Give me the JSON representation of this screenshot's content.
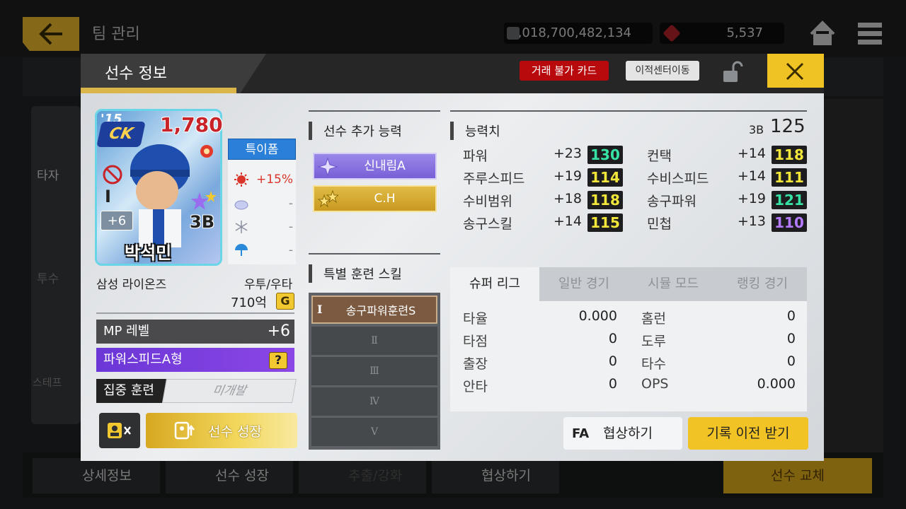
{
  "background": {
    "title": "팀 관리",
    "gold": "1,018,700,482,134",
    "gems": "5,537",
    "bottom_buttons": [
      "상세정보",
      "선수 성장",
      "추출/강화",
      "협상하기",
      "선수 교체"
    ],
    "side_labels": [
      "타자",
      "투수",
      "스테프"
    ]
  },
  "modal": {
    "title": "선수 정보",
    "trade_badge": "거래 불가 카드",
    "transfer_button": "이적센터이동",
    "close_icon": "close-icon",
    "accent_color": "#f0c324"
  },
  "card": {
    "year": "'15",
    "logo": "CK",
    "rating": "1,780",
    "plus": "+6",
    "position": "3B",
    "name": "박석민",
    "roman": "I",
    "special": "특이폼",
    "conditions": [
      {
        "icon": "sun-icon",
        "value": "+15%"
      },
      {
        "icon": "cloud-icon",
        "value": "-"
      },
      {
        "icon": "snow-icon",
        "value": "-"
      },
      {
        "icon": "umbrella-icon",
        "value": "-"
      }
    ]
  },
  "info": {
    "team": "삼성 라이온즈",
    "bats": "우투/우타",
    "salary": "710억",
    "salary_icon": "G",
    "mp_label": "MP 레벨",
    "mp_value": "+6",
    "type_label": "파워스피드A형",
    "type_help": "?",
    "focus_label": "집중 훈련",
    "focus_value": "미개발",
    "grow_button": "선수 성장"
  },
  "abilities": {
    "title": "선수 추가 능력",
    "items": [
      "신내림A",
      "C.H"
    ]
  },
  "training": {
    "title": "특별 훈련 스킬",
    "slots": [
      "송구파워훈련S",
      "Ⅱ",
      "Ⅲ",
      "Ⅳ",
      "Ⅴ"
    ],
    "slot1_icon": "I"
  },
  "stats": {
    "title": "능력치",
    "pos_small": "3B",
    "total": "125",
    "left": [
      {
        "name": "파워",
        "plus": "+23",
        "value": "130",
        "color": "green"
      },
      {
        "name": "주루스피드",
        "plus": "+19",
        "value": "114",
        "color": "yellow"
      },
      {
        "name": "수비범위",
        "plus": "+18",
        "value": "118",
        "color": "yellow"
      },
      {
        "name": "송구스킬",
        "plus": "+14",
        "value": "115",
        "color": "yellow"
      }
    ],
    "right": [
      {
        "name": "컨택",
        "plus": "+14",
        "value": "118",
        "color": "yellow"
      },
      {
        "name": "수비스피드",
        "plus": "+14",
        "value": "111",
        "color": "yellow"
      },
      {
        "name": "송구파워",
        "plus": "+19",
        "value": "121",
        "color": "green"
      },
      {
        "name": "민첩",
        "plus": "+13",
        "value": "110",
        "color": "purple"
      }
    ]
  },
  "records": {
    "tabs": [
      "슈퍼 리그",
      "일반 경기",
      "시뮬 모드",
      "랭킹 경기"
    ],
    "active_tab": 0,
    "left": [
      {
        "name": "타율",
        "value": "0.000"
      },
      {
        "name": "타점",
        "value": "0"
      },
      {
        "name": "출장",
        "value": "0"
      },
      {
        "name": "안타",
        "value": "0"
      }
    ],
    "right": [
      {
        "name": "홈런",
        "value": "0"
      },
      {
        "name": "도루",
        "value": "0"
      },
      {
        "name": "타수",
        "value": "0"
      },
      {
        "name": "OPS",
        "value": "0.000"
      }
    ]
  },
  "actions": {
    "fa_icon": "FA",
    "fa_button": "협상하기",
    "record_button": "기록 이전 받기"
  }
}
